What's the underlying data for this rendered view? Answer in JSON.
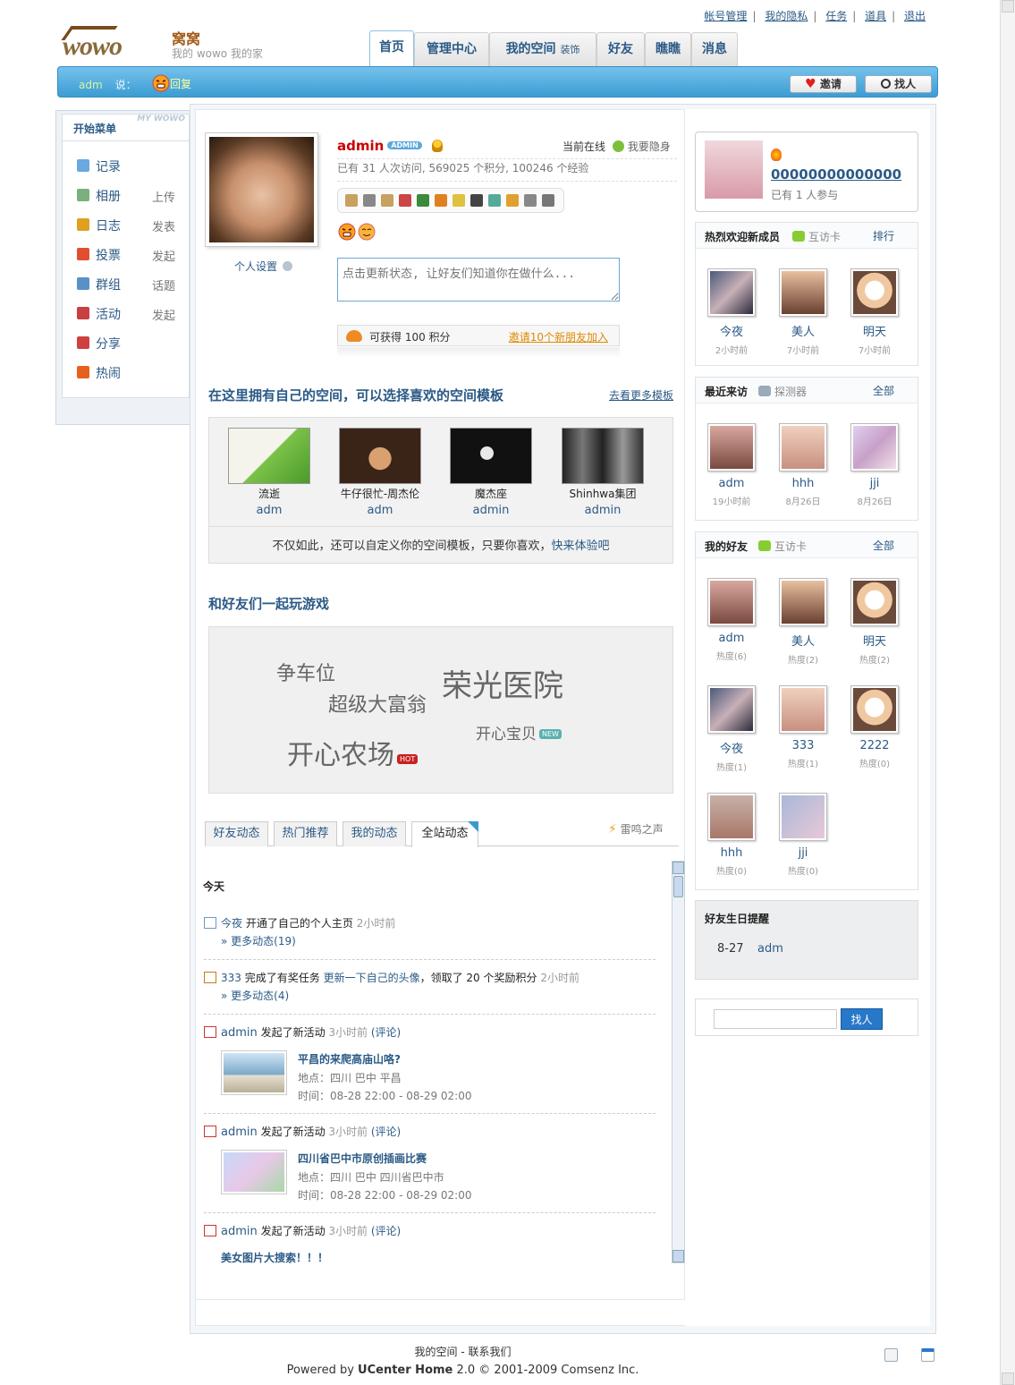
{
  "top_links": [
    "帐号管理",
    "我的隐私",
    "任务",
    "道具",
    "退出"
  ],
  "logo": {
    "word": "wowo",
    "cn": "窝窝",
    "sub": "我的 wowo 我的家"
  },
  "nav_tabs": [
    {
      "label": "首页",
      "extra": ""
    },
    {
      "label": "管理中心",
      "extra": ""
    },
    {
      "label": "我的空间",
      "extra": "装饰"
    },
    {
      "label": "好友",
      "extra": ""
    },
    {
      "label": "瞧瞧",
      "extra": ""
    },
    {
      "label": "消息",
      "extra": ""
    }
  ],
  "bar": {
    "user": "adm",
    "says": "说：",
    "reply": "回复",
    "invite": "邀请",
    "find": "找人"
  },
  "left_menu": {
    "title": "开始菜单",
    "mark": "MY WOWO",
    "items": [
      {
        "label": "记录",
        "extra": "",
        "color": "#6aa8e0"
      },
      {
        "label": "相册",
        "extra": "上传",
        "color": "#7ab07a"
      },
      {
        "label": "日志",
        "extra": "发表",
        "color": "#e0a020"
      },
      {
        "label": "投票",
        "extra": "发起",
        "color": "#e05030"
      },
      {
        "label": "群组",
        "extra": "话题",
        "color": "#5a90c8"
      },
      {
        "label": "活动",
        "extra": "发起",
        "color": "#c84040"
      },
      {
        "label": "分享",
        "extra": "",
        "color": "#d04040"
      },
      {
        "label": "热闹",
        "extra": "",
        "color": "#e86020"
      }
    ]
  },
  "profile": {
    "name": "admin",
    "badge": "ADMIN",
    "online": "当前在线",
    "hide": "我要隐身",
    "stats": "已有 31 人次访问, 569025 个积分, 100246 个经验",
    "settings": "个人设置",
    "status_placeholder": "点击更新状态, 让好友们知道你在做什么...",
    "gain": "可获得  100 积分",
    "invite": "邀请10个新朋友加入"
  },
  "templates": {
    "heading": "在这里拥有自己的空间，可以选择喜欢的空间模板",
    "more": "去看更多模板",
    "items": [
      {
        "name": "流逝",
        "author": "adm"
      },
      {
        "name": "牛仔很忙-周杰伦",
        "author": "adm"
      },
      {
        "name": "魔杰座",
        "author": "admin"
      },
      {
        "name": "Shinhwa集团",
        "author": "admin"
      }
    ],
    "note": "不仅如此，还可以自定义你的空间模板，只要你喜欢，",
    "note_link": "快来体验吧"
  },
  "games": {
    "heading": "和好友们一起玩游戏",
    "items": [
      "争车位",
      "超级大富翁",
      "荣光医院",
      "开心宝贝",
      "开心农场"
    ],
    "new_tag": "NEW",
    "hot_tag": "HOT"
  },
  "feed_tabs": [
    "好友动态",
    "热门推荐",
    "我的动态",
    "全站动态"
  ],
  "thunder": "雷鸣之声",
  "feed": {
    "today": "今天",
    "items": [
      {
        "user": "今夜",
        "action": "开通了自己的个人主页",
        "time": "2小时前",
        "more": "» 更多动态(19)"
      },
      {
        "user": "333",
        "action": "完成了有奖任务",
        "task": "更新一下自己的头像",
        "reward": "，领取了  20 个奖励积分",
        "time": "2小时前",
        "more": "» 更多动态(4)"
      },
      {
        "user": "admin",
        "action": "发起了新活动",
        "time": "3小时前",
        "comment": "(评论)",
        "title": "平昌的来爬高庙山咯?",
        "place": "地点：四川  巴中  平昌",
        "when": "时间：08-28 22:00 - 08-29 02:00"
      },
      {
        "user": "admin",
        "action": "发起了新活动",
        "time": "3小时前",
        "comment": "(评论)",
        "title": "四川省巴中市原创插画比赛",
        "place": "地点：四川  巴中  四川省巴中市",
        "when": "时间：08-28 22:00 - 08-29 02:00"
      },
      {
        "user": "admin",
        "action": "发起了新活动",
        "time": "3小时前",
        "comment": "(评论)",
        "title": "美女图片大搜索！！！"
      }
    ]
  },
  "event": {
    "title": "00000000000000",
    "count": "已有  1 人参与"
  },
  "new_members": {
    "title": "热烈欢迎新成员",
    "card": "互访卡",
    "right": "排行",
    "items": [
      {
        "name": "今夜",
        "sub": "2小时前"
      },
      {
        "name": "美人",
        "sub": "7小时前"
      },
      {
        "name": "明天",
        "sub": "7小时前"
      }
    ]
  },
  "visitors": {
    "title": "最近来访",
    "card": "探测器",
    "right": "全部",
    "items": [
      {
        "name": "adm",
        "sub": "19小时前"
      },
      {
        "name": "hhh",
        "sub": "8月26日"
      },
      {
        "name": "jji",
        "sub": "8月26日"
      }
    ]
  },
  "friends": {
    "title": "我的好友",
    "card": "互访卡",
    "right": "全部",
    "items": [
      {
        "name": "adm",
        "sub": "热度(6)"
      },
      {
        "name": "美人",
        "sub": "热度(2)"
      },
      {
        "name": "明天",
        "sub": "热度(2)"
      },
      {
        "name": "今夜",
        "sub": "热度(1)"
      },
      {
        "name": "333",
        "sub": "热度(1)"
      },
      {
        "name": "2222",
        "sub": "热度(0)"
      },
      {
        "name": "hhh",
        "sub": "热度(0)"
      },
      {
        "name": "jji",
        "sub": "热度(0)"
      }
    ]
  },
  "birthday": {
    "title": "好友生日提醒",
    "date": "8-27",
    "name": "adm"
  },
  "search": {
    "button": "找人"
  },
  "footer": {
    "links": "我的空间  - 联系我们",
    "powered": "Powered by ",
    "brand": "UCenter Home",
    "rest": " 2.0 © 2001-2009 Comsenz Inc."
  },
  "colors": {
    "accent": "#2b5a86",
    "bar": "#3c9cd3",
    "name": "#cc0000"
  }
}
